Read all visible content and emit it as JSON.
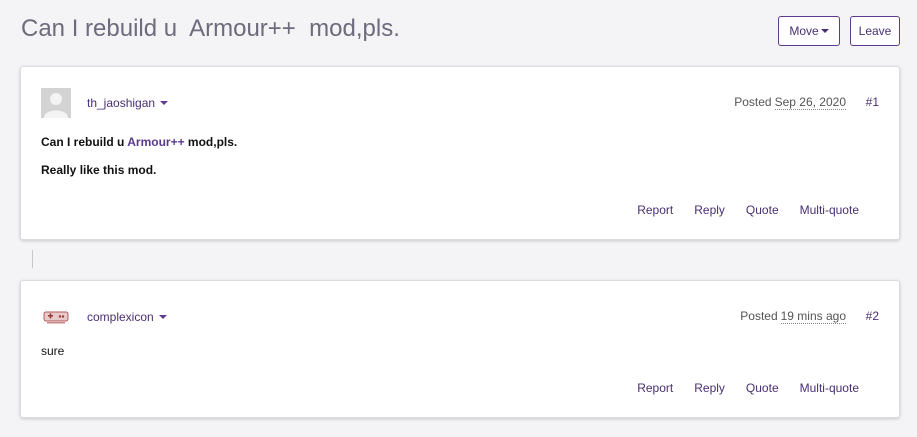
{
  "topic": {
    "title": "Can I rebuild u  Armour++  mod,pls.",
    "move_label": "Move",
    "leave_label": "Leave"
  },
  "posts": [
    {
      "author": "th_jaoshigan",
      "posted_label": "Posted",
      "date": "Sep 26, 2020",
      "number": "#1",
      "body_line1_pre": "Can I rebuild u ",
      "body_line1_link": "Armour++",
      "body_line1_post": " mod,pls.",
      "body_line2": "Really like this mod."
    },
    {
      "author": "complexicon",
      "posted_label": "Posted",
      "date": "19 mins ago",
      "number": "#2",
      "body": "sure"
    }
  ],
  "actions": {
    "report": "Report",
    "reply": "Reply",
    "quote": "Quote",
    "multi_quote": "Multi-quote"
  },
  "colors": {
    "accent": "#4a2f73",
    "title": "#6d6b7c",
    "background": "#f4f4f6"
  },
  "icons": {
    "avatar_1": "default-user-avatar-icon",
    "avatar_2": "game-controller-avatar-icon",
    "dropdown": "caret-down-icon"
  }
}
